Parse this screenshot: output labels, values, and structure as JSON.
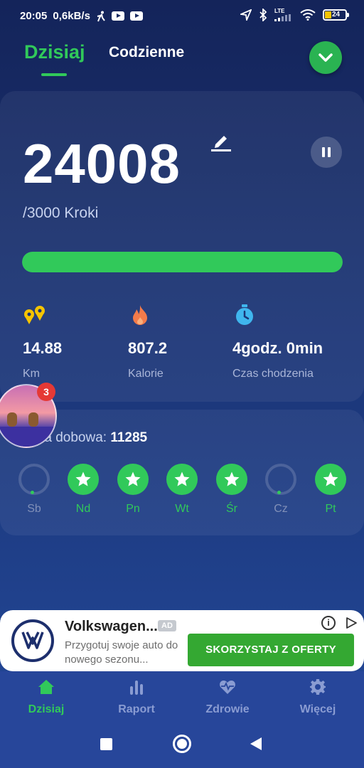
{
  "status_bar": {
    "time": "20:05",
    "speed": "0,6kB/s",
    "network": "LTE",
    "battery": "24",
    "icons": [
      "walking-icon",
      "youtube-icon",
      "youtube-icon",
      "location-icon",
      "bluetooth-icon",
      "signal-icon",
      "wifi-icon",
      "battery-icon"
    ]
  },
  "header": {
    "tab_active": "Dzisiaj",
    "tab_inactive": "Codzienne",
    "action_icon": "chevron-down-icon"
  },
  "steps_card": {
    "steps": "24008",
    "goal": "/3000 Kroki",
    "progress": 1.0,
    "stats": [
      {
        "value": "14.88",
        "label": "Km",
        "icon": "distance-icon"
      },
      {
        "value": "807.2",
        "label": "Kalorie",
        "icon": "flame-icon"
      },
      {
        "value": "4godz. 0min",
        "label": "Czas chodzenia",
        "icon": "timer-icon"
      }
    ]
  },
  "bubble": {
    "badge": "3"
  },
  "week": {
    "average_label": "Średnia dobowa: ",
    "average_visible_label": "unia dobowa: ",
    "average_value": "11285",
    "days": [
      {
        "label": "Sb",
        "done": false
      },
      {
        "label": "Nd",
        "done": true
      },
      {
        "label": "Pn",
        "done": true
      },
      {
        "label": "Wt",
        "done": true
      },
      {
        "label": "Śr",
        "done": true
      },
      {
        "label": "Cz",
        "done": false
      },
      {
        "label": "Pt",
        "done": true
      }
    ]
  },
  "ad": {
    "title": "Volkswagen...",
    "tag": "AD",
    "text": "Przygotuj swoje auto do nowego sezonu...",
    "cta": "SKORZYSTAJ Z OFERTY",
    "info": "i"
  },
  "bottom_nav": [
    {
      "label": "Dzisiaj",
      "icon": "home-icon",
      "active": true
    },
    {
      "label": "Raport",
      "icon": "bar-chart-icon",
      "active": false
    },
    {
      "label": "Zdrowie",
      "icon": "heart-pulse-icon",
      "active": false
    },
    {
      "label": "Więcej",
      "icon": "gear-icon",
      "active": false
    }
  ],
  "colors": {
    "accent": "#31c95a",
    "background_top": "#14245a",
    "background_bottom": "#23499a",
    "ad_cta": "#34a832"
  }
}
